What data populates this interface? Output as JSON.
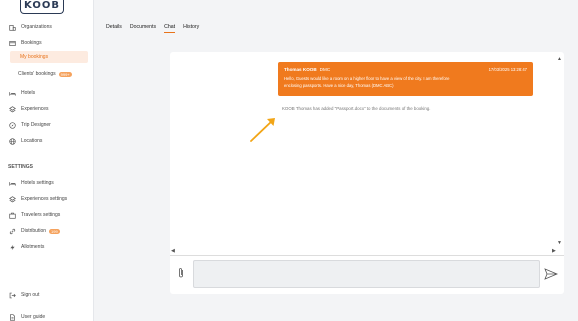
{
  "brand": {
    "logo_text": "KOOB"
  },
  "sidebar": {
    "items": [
      {
        "label": "Organizations",
        "icon": "organization-icon"
      },
      {
        "label": "Bookings",
        "icon": "bookings-icon"
      },
      {
        "label": "My bookings",
        "icon": "",
        "active": true
      },
      {
        "label": "Clients' bookings",
        "icon": "",
        "badge": "999+"
      },
      {
        "label": "Hotels",
        "icon": "bed-icon"
      },
      {
        "label": "Experiences",
        "icon": "layers-icon"
      },
      {
        "label": "Trip Designer",
        "icon": "compass-icon"
      },
      {
        "label": "Locations",
        "icon": "globe-icon"
      }
    ],
    "settings_title": "SETTINGS",
    "settings_items": [
      {
        "label": "Hotels settings",
        "icon": "bed-icon"
      },
      {
        "label": "Experiences settings",
        "icon": "layers-icon"
      },
      {
        "label": "Travelers settings",
        "icon": "suitcase-icon"
      },
      {
        "label": "Distribution",
        "icon": "link-icon",
        "badge": "199"
      },
      {
        "label": "Allotments",
        "icon": "bolt-icon"
      }
    ],
    "bottom_items": [
      {
        "label": "Sign out",
        "icon": "sign-out-icon"
      },
      {
        "label": "User guide",
        "icon": "document-icon"
      }
    ]
  },
  "tabs": [
    "Details",
    "Documents",
    "Chat",
    "History"
  ],
  "active_tab": "Chat",
  "chat": {
    "message": {
      "author": "Thomas KOOB",
      "org": "DMC",
      "timestamp": "17/03/2025 13:28:47",
      "body": "Hello, Guests would like a room on a higher floor to have a view of the city. I am therefore enclosing passports. Have a nice day, Thomas (DMC ABC)"
    },
    "system_message": "KOOB Thomas has added \"Passport.docx\" to the documents of the booking.",
    "input_value": "",
    "input_placeholder": ""
  },
  "colors": {
    "accent": "#f07a1e",
    "annotation_arrow": "#f2a516",
    "active_bg": "#fdebe0"
  }
}
